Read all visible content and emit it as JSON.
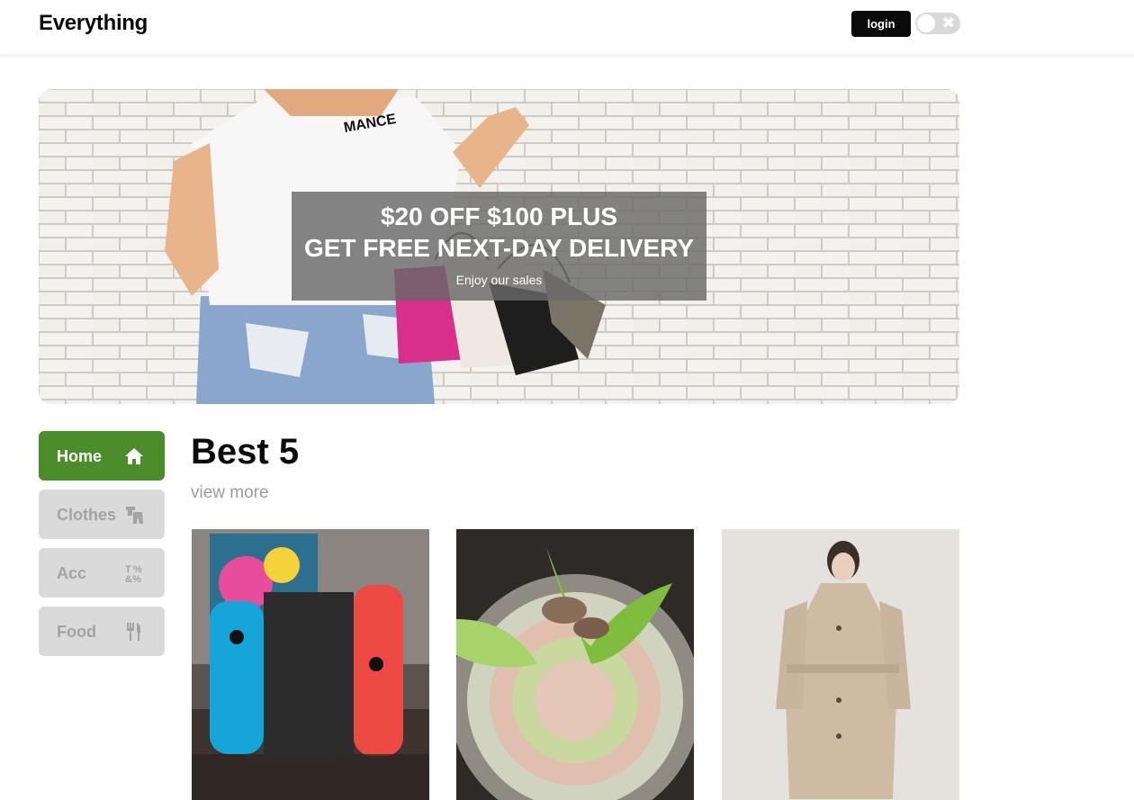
{
  "header": {
    "logo": "Everything",
    "login_label": "login",
    "theme_toggle": {
      "state": "off",
      "icon": "close-icon"
    }
  },
  "banner": {
    "headline_line1": "$20 OFF $100 PLUS",
    "headline_line2": "GET FREE NEXT-DAY DELIVERY",
    "subtext": "Enjoy our sales",
    "shirt_text": "MANCE"
  },
  "sidebar": {
    "items": [
      {
        "label": "Home",
        "icon": "home-icon",
        "active": true
      },
      {
        "label": "Clothes",
        "icon": "clothes-icon",
        "active": false
      },
      {
        "label": "Acc",
        "icon": "accessories-icon",
        "active": false
      },
      {
        "label": "Food",
        "icon": "food-icon",
        "active": false
      }
    ]
  },
  "section": {
    "title": "Best 5",
    "view_more": "view more"
  },
  "products": [
    {
      "image": "game-console-photo"
    },
    {
      "image": "hot-pot-photo"
    },
    {
      "image": "beige-coat-photo"
    }
  ],
  "colors": {
    "accent_green": "#4a8d2a",
    "inactive_gray": "#dadada",
    "login_black": "#0b0b0b"
  }
}
